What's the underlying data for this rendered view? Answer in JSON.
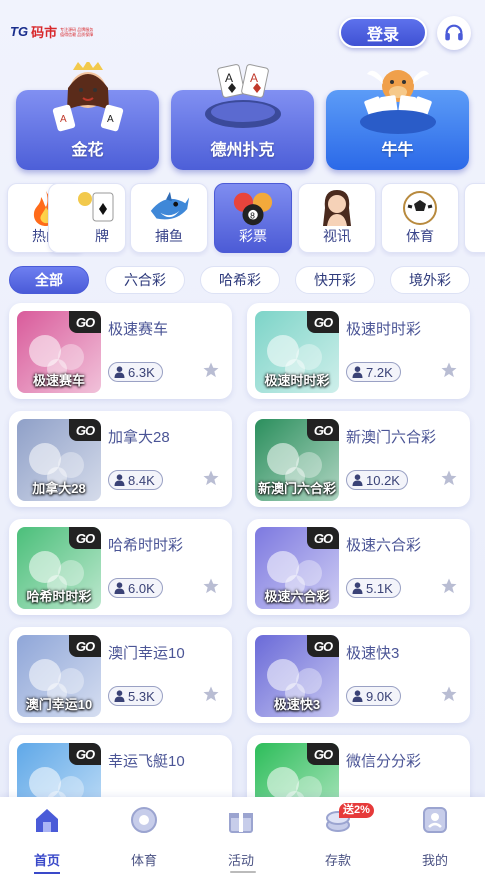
{
  "header": {
    "logo_mark": "TG",
    "logo_name": "码市",
    "logo_tagline": "专注源码 品牌服务 值得信赖 品质保障",
    "login_label": "登录",
    "support_icon": "headset-icon"
  },
  "featured_games": [
    {
      "label": "金花",
      "icon": "poker-girl-icon"
    },
    {
      "label": "德州扑克",
      "icon": "poker-table-icon"
    },
    {
      "label": "牛牛",
      "icon": "bull-cards-icon"
    }
  ],
  "categories": [
    {
      "label": "热门",
      "icon": "fire-icon",
      "active": false
    },
    {
      "label": "牌",
      "icon": "playing-card-icon",
      "active": false
    },
    {
      "label": "捕鱼",
      "icon": "shark-icon",
      "active": false
    },
    {
      "label": "彩票",
      "icon": "lottery-balls-icon",
      "active": true
    },
    {
      "label": "视讯",
      "icon": "dealer-icon",
      "active": false
    },
    {
      "label": "体育",
      "icon": "soccer-ball-icon",
      "active": false
    }
  ],
  "filters": [
    "全部",
    "六合彩",
    "哈希彩",
    "快开彩",
    "境外彩"
  ],
  "filters_active": "全部",
  "go_badge": "GO",
  "lotteries": [
    {
      "name": "极速赛车",
      "thumb_label": "极速赛车",
      "online": "6.3K",
      "color": "#d95b9b"
    },
    {
      "name": "极速时时彩",
      "thumb_label": "极速时时彩",
      "online": "7.2K",
      "color": "#7dd4c8"
    },
    {
      "name": "加拿大28",
      "thumb_label": "加拿大28",
      "online": "8.4K",
      "color": "#8fa0c8"
    },
    {
      "name": "新澳门六合彩",
      "thumb_label": "新澳门六合彩",
      "online": "10.2K",
      "color": "#2b8f5d"
    },
    {
      "name": "哈希时时彩",
      "thumb_label": "哈希时时彩",
      "online": "6.0K",
      "color": "#4bbf7a"
    },
    {
      "name": "极速六合彩",
      "thumb_label": "极速六合彩",
      "online": "5.1K",
      "color": "#7d79e0"
    },
    {
      "name": "澳门幸运10",
      "thumb_label": "澳门幸运10",
      "online": "5.3K",
      "color": "#8fa6d8"
    },
    {
      "name": "极速快3",
      "thumb_label": "极速快3",
      "online": "9.0K",
      "color": "#6a6ad8"
    },
    {
      "name": "幸运飞艇10",
      "thumb_label": "",
      "online": "",
      "color": "#5fa8e8"
    },
    {
      "name": "微信分分彩",
      "thumb_label": "",
      "online": "",
      "color": "#2dbd5a"
    }
  ],
  "tabs": [
    {
      "label": "首页",
      "icon": "home-icon",
      "active": true
    },
    {
      "label": "体育",
      "icon": "sports-icon",
      "active": false
    },
    {
      "label": "活动",
      "icon": "gift-icon",
      "active": false
    },
    {
      "label": "存款",
      "icon": "deposit-icon",
      "active": false
    },
    {
      "label": "我的",
      "icon": "profile-icon",
      "active": false
    }
  ],
  "deposit_promo": "送2%",
  "colors": {
    "primary": "#4a5bd8",
    "accent_blue": "#2b69e8",
    "promo_red": "#e63a3a"
  }
}
